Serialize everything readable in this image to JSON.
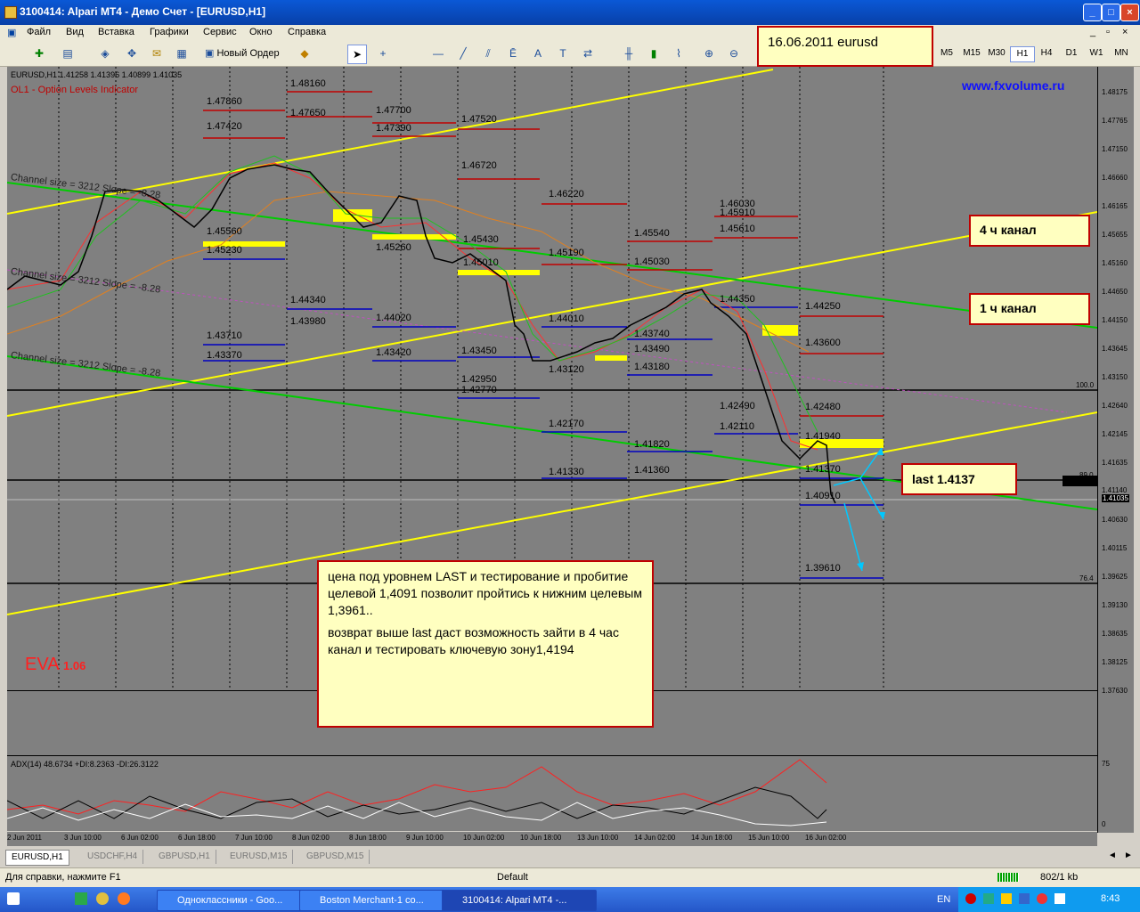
{
  "window": {
    "title": "3100414: Alpari MT4 - Демо Счет - [EURUSD,H1]"
  },
  "menu": [
    "Файл",
    "Вид",
    "Вставка",
    "Графики",
    "Сервис",
    "Окно",
    "Справка"
  ],
  "toolbar": {
    "new_order": "Новый Ордер",
    "timeframes": [
      "M5",
      "M15",
      "M30",
      "H1",
      "H4",
      "D1",
      "W1",
      "MN"
    ],
    "active_tf": "H1",
    "draw_tools": [
      "A",
      "T"
    ]
  },
  "chart": {
    "header": "EURUSD,H1  1.41258 1.41396 1.40899 1.41035",
    "indicator": "OL1 - Option Levels Indicator",
    "watermark": "www.fxvolume.ru",
    "channel_labels": [
      "Channel size = 3212 Slope = -8.28",
      "Channel size = 3212 Slope = -8.28",
      "Channel size = 3212 Slope = -8.28"
    ],
    "eva": "EVA",
    "eva_val": "1.06",
    "levels": [
      "1.48160",
      "1.47860",
      "1.47650",
      "1.47700",
      "1.47520",
      "1.47420",
      "1.47390",
      "1.46720",
      "1.46220",
      "1.46030",
      "1.45910",
      "1.45610",
      "1.45540",
      "1.45430",
      "1.45190",
      "1.45030",
      "1.45010",
      "1.45560",
      "1.45230",
      "1.45260",
      "1.44340",
      "1.43980",
      "1.44020",
      "1.43710",
      "1.43370",
      "1.43420",
      "1.43450",
      "1.42950",
      "1.42770",
      "1.44350",
      "1.44010",
      "1.43740",
      "1.43490",
      "1.43180",
      "1.43120",
      "1.42490",
      "1.42110",
      "1.42170",
      "1.41820",
      "1.41360",
      "1.41330",
      "1.44250",
      "1.43600",
      "1.42480",
      "1.41940",
      "1.41370",
      "1.40910",
      "1.39610"
    ],
    "fib": [
      "100.0",
      "89.0",
      "76.4"
    ],
    "adx_label": "ADX(14) 48.6734 +DI:8.2363 -DI:26.3122",
    "adx_scale": [
      "75",
      "0"
    ]
  },
  "price_axis": [
    "1.48175",
    "1.47765",
    "1.47150",
    "1.46660",
    "1.46165",
    "1.45655",
    "1.45160",
    "1.44650",
    "1.44150",
    "1.43645",
    "1.43150",
    "1.42640",
    "1.42145",
    "1.41635",
    "1.41140",
    "1.41035",
    "1.40630",
    "1.40115",
    "1.39625",
    "1.39130",
    "1.38635",
    "1.38125",
    "1.37630"
  ],
  "date_axis": [
    "2 Jun 2011",
    "3 Jun 10:00",
    "6 Jun 02:00",
    "6 Jun 18:00",
    "7 Jun 10:00",
    "8 Jun 02:00",
    "8 Jun 18:00",
    "9 Jun 10:00",
    "10 Jun 02:00",
    "10 Jun 18:00",
    "13 Jun 10:00",
    "14 Jun 02:00",
    "14 Jun 18:00",
    "15 Jun 10:00",
    "16 Jun 02:00"
  ],
  "notes": {
    "date_title": "16.06.2011 eurusd",
    "channel4h": "4 ч канал",
    "channel1h": "1 ч канал",
    "last": "last 1.4137",
    "main_p1": "цена под  уровнем LAST   и тестирование и пробитие  целевой 1,4091 позволит пройтись к  нижним целевым 1,3961..",
    "main_p2": "возврат  выше  last даст возможность зайти в  4 час канал и тестировать ключевую зону1,4194"
  },
  "tabs": [
    "EURUSD,H1",
    "USDCHF,H4",
    "GBPUSD,H1",
    "EURUSD,M15",
    "GBPUSD,M15"
  ],
  "status": {
    "help": "Для справки, нажмите F1",
    "profile": "Default",
    "traffic": "802/1 kb"
  },
  "taskbar": {
    "items": [
      "Одноклассники - Goo...",
      "Boston Merchant-1 co...",
      "3100414: Alpari MT4 -..."
    ],
    "lang": "EN",
    "time": "8:43"
  },
  "colors": {
    "chart_bg": "#808080",
    "yellow": "#ffff00",
    "green": "#00cc00",
    "red_level": "#c00000",
    "blue_level": "#0000c0"
  }
}
